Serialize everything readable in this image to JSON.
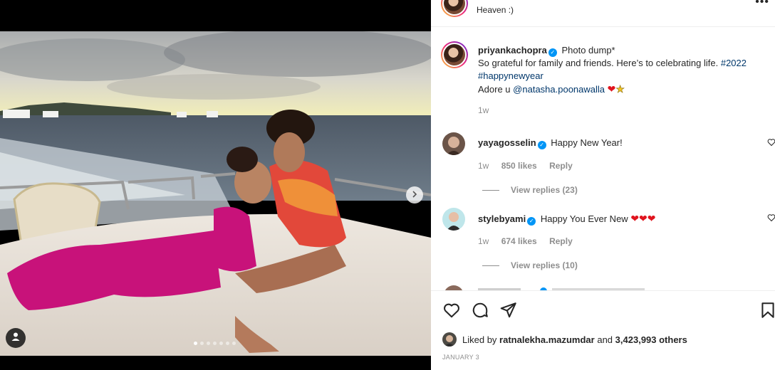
{
  "post": {
    "header_subtitle": "Heaven :)",
    "more_label": "•••",
    "caption": {
      "username": "priyankachopra",
      "verified_mark": "✓",
      "line1": "Photo dump*",
      "line2": "So grateful for family and friends. Here’s to celebrating life.",
      "hashtag1": "#2022",
      "hashtag2": "#happynewyear",
      "line3_prefix": "Adore u",
      "mention": "@natasha.poonawalla",
      "emoji_heart": "❤",
      "emoji_star": "★",
      "time": "1w"
    },
    "comments": [
      {
        "username": "yayagosselin",
        "text": "Happy New Year!",
        "emojis": "",
        "time": "1w",
        "likes": "850 likes",
        "reply_label": "Reply",
        "view_replies": "View replies (23)"
      },
      {
        "username": "stylebyami",
        "text": "Happy You Ever New",
        "emojis": "❤❤❤",
        "time": "1w",
        "likes": "674 likes",
        "reply_label": "Reply",
        "view_replies": "View replies (10)"
      }
    ],
    "likes": {
      "prefix": "Liked by",
      "liker": "ratnalekha.mazumdar",
      "conjunction": "and",
      "others": "3,423,993 others"
    },
    "date": "JANUARY 3",
    "carousel": {
      "total": 7,
      "active_index": 0
    },
    "icons": {
      "like": "heart-icon",
      "comment": "comment-icon",
      "share": "share-icon",
      "save": "bookmark-icon",
      "next": "chevron-right-icon",
      "tags": "user-tag-icon"
    },
    "colors": {
      "link": "#00376b",
      "verified": "#0095f6",
      "muted": "#8e8e8e",
      "heart": "#e0141e"
    }
  }
}
